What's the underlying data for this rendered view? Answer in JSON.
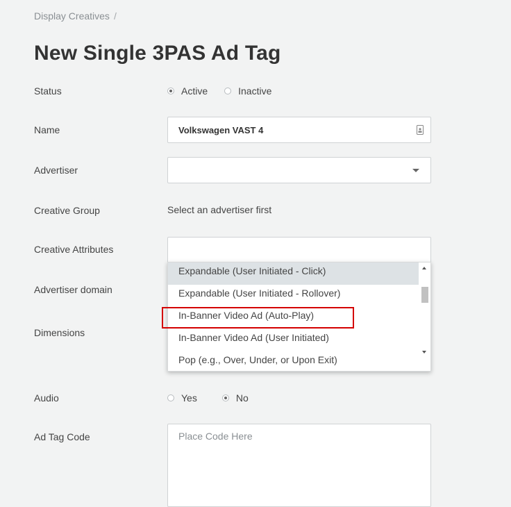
{
  "breadcrumb": {
    "item": "Display Creatives",
    "separator": "/"
  },
  "page_title": "New Single 3PAS Ad Tag",
  "fields": {
    "status": {
      "label": "Status",
      "options": [
        "Active",
        "Inactive"
      ],
      "selected": "Active"
    },
    "name": {
      "label": "Name",
      "value": "Volkswagen VAST 4"
    },
    "advertiser": {
      "label": "Advertiser",
      "value": ""
    },
    "creative_group": {
      "label": "Creative Group",
      "helper": "Select an advertiser first"
    },
    "creative_attributes": {
      "label": "Creative Attributes",
      "dropdown_options": [
        "Expandable (User Initiated - Click)",
        "Expandable (User Initiated - Rollover)",
        "In-Banner Video Ad (Auto-Play)",
        "In-Banner Video Ad (User Initiated)",
        "Pop (e.g., Over, Under, or Upon Exit)"
      ],
      "highlighted_option": "Expandable (User Initiated - Click)"
    },
    "advertiser_domain": {
      "label": "Advertiser domain"
    },
    "dimensions": {
      "label": "Dimensions"
    },
    "audio": {
      "label": "Audio",
      "options": [
        "Yes",
        "No"
      ],
      "selected": "No"
    },
    "ad_tag_code": {
      "label": "Ad Tag Code",
      "placeholder": "Place Code Here"
    }
  },
  "colors": {
    "background": "#f2f3f3",
    "highlight": "#dde2e5",
    "annotation_box": "#d40000"
  }
}
